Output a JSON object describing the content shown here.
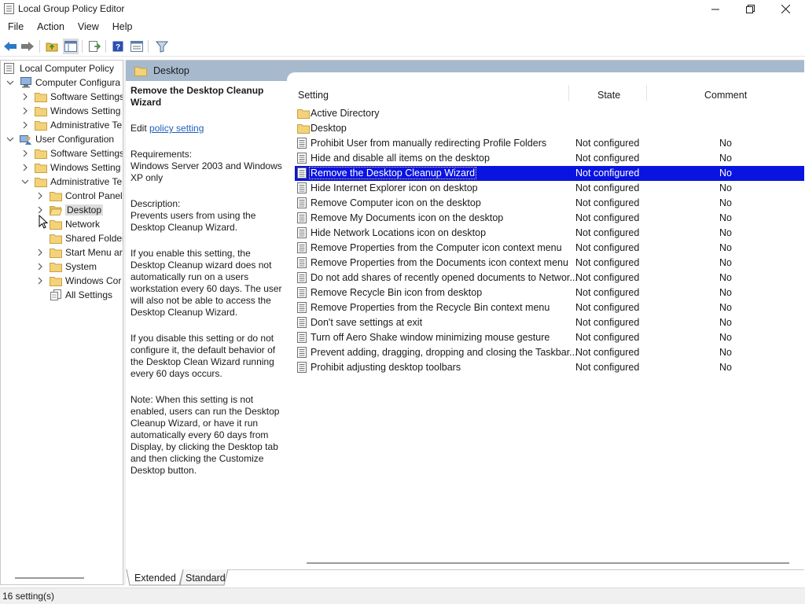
{
  "window": {
    "title": "Local Group Policy Editor"
  },
  "menu": [
    "File",
    "Action",
    "View",
    "Help"
  ],
  "toolbar_icons": [
    "back-arrow-icon",
    "forward-arrow-icon",
    "up-folder-icon",
    "show-hide-tree-icon",
    "export-list-icon",
    "help-icon",
    "properties-icon",
    "filter-icon"
  ],
  "tree": {
    "root": "Local Computer Policy",
    "items": [
      {
        "label": "Computer Configura",
        "icon": "computer-icon"
      },
      {
        "label": "Software Settings",
        "icon": "folder-icon"
      },
      {
        "label": "Windows Setting",
        "icon": "folder-icon"
      },
      {
        "label": "Administrative Te",
        "icon": "folder-icon"
      },
      {
        "label": "User Configuration",
        "icon": "user-icon"
      },
      {
        "label": "Software Settings",
        "icon": "folder-icon"
      },
      {
        "label": "Windows Setting",
        "icon": "folder-icon"
      },
      {
        "label": "Administrative Te",
        "icon": "folder-icon"
      },
      {
        "label": "Control Panel",
        "icon": "folder-icon"
      },
      {
        "label": "Desktop",
        "icon": "folder-open-icon"
      },
      {
        "label": "Network",
        "icon": "folder-icon"
      },
      {
        "label": "Shared Folder",
        "icon": "folder-icon"
      },
      {
        "label": "Start Menu ar",
        "icon": "folder-icon"
      },
      {
        "label": "System",
        "icon": "folder-icon"
      },
      {
        "label": "Windows Cor",
        "icon": "folder-icon"
      },
      {
        "label": "All Settings",
        "icon": "all-settings-icon"
      }
    ]
  },
  "content": {
    "header": "Desktop",
    "description": {
      "title": "Remove the Desktop Cleanup Wizard",
      "edit_prefix": "Edit",
      "edit_link": "policy setting",
      "requirements_label": "Requirements:",
      "requirements": "Windows Server 2003 and Windows XP only",
      "description_label": "Description:",
      "description": "Prevents users from using the Desktop Cleanup Wizard.",
      "para_enable": "If you enable this setting, the Desktop Cleanup wizard does not automatically run on a users workstation every 60 days. The user will also not be able to access the Desktop Cleanup Wizard.",
      "para_disable": "If you disable this setting or do not configure it, the default behavior of the Desktop Clean Wizard running every 60 days occurs.",
      "para_note": "Note: When this setting is not enabled, users can run the Desktop Cleanup Wizard, or have it run automatically every 60 days from Display, by clicking the Desktop tab and then clicking the Customize Desktop button."
    },
    "columns": {
      "setting": "Setting",
      "state": "State",
      "comment": "Comment"
    },
    "folders": [
      "Active Directory",
      "Desktop"
    ],
    "settings": [
      {
        "name": "Prohibit User from manually redirecting Profile Folders",
        "state": "Not configured",
        "comment": "No"
      },
      {
        "name": "Hide and disable all items on the desktop",
        "state": "Not configured",
        "comment": "No"
      },
      {
        "name": "Remove the Desktop Cleanup Wizard",
        "state": "Not configured",
        "comment": "No"
      },
      {
        "name": "Hide Internet Explorer icon on desktop",
        "state": "Not configured",
        "comment": "No"
      },
      {
        "name": "Remove Computer icon on the desktop",
        "state": "Not configured",
        "comment": "No"
      },
      {
        "name": "Remove My Documents icon on the desktop",
        "state": "Not configured",
        "comment": "No"
      },
      {
        "name": "Hide Network Locations icon on desktop",
        "state": "Not configured",
        "comment": "No"
      },
      {
        "name": "Remove Properties from the Computer icon context menu",
        "state": "Not configured",
        "comment": "No"
      },
      {
        "name": "Remove Properties from the Documents icon context menu",
        "state": "Not configured",
        "comment": "No"
      },
      {
        "name": "Do not add shares of recently opened documents to Networ...",
        "state": "Not configured",
        "comment": "No"
      },
      {
        "name": "Remove Recycle Bin icon from desktop",
        "state": "Not configured",
        "comment": "No"
      },
      {
        "name": "Remove Properties from the Recycle Bin context menu",
        "state": "Not configured",
        "comment": "No"
      },
      {
        "name": "Don't save settings at exit",
        "state": "Not configured",
        "comment": "No"
      },
      {
        "name": "Turn off Aero Shake window minimizing mouse gesture",
        "state": "Not configured",
        "comment": "No"
      },
      {
        "name": "Prevent adding, dragging, dropping and closing the Taskbar...",
        "state": "Not configured",
        "comment": "No"
      },
      {
        "name": "Prohibit adjusting desktop toolbars",
        "state": "Not configured",
        "comment": "No"
      }
    ],
    "selected_setting_index": 2,
    "tabs": [
      "Extended",
      "Standard"
    ]
  },
  "status": {
    "text": "16 setting(s)"
  },
  "colors": {
    "header_band": "#a7b9cd",
    "selection": "#0a14e0",
    "link": "#1f5fbf"
  }
}
